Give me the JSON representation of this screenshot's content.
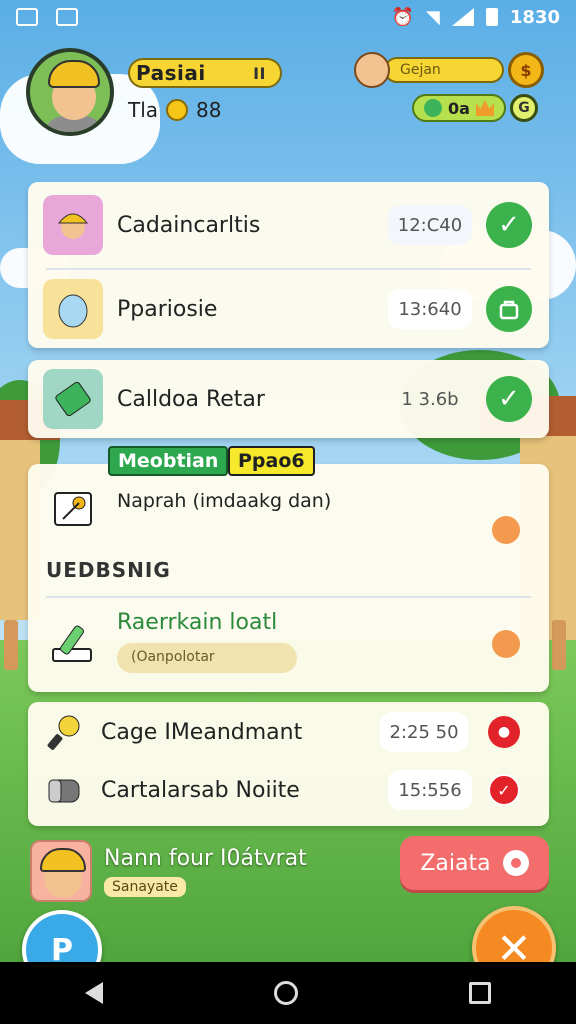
{
  "status_bar": {
    "left_icons": [
      "notification-icon",
      "gallery-icon"
    ],
    "right_icons": [
      "alarm-icon",
      "wifi-icon",
      "signal-icon",
      "battery-icon"
    ],
    "time": "1830"
  },
  "player": {
    "name": "Pasiai",
    "pause_label": "II",
    "level_prefix": "Tla",
    "chick_count": "88"
  },
  "resources": {
    "bar_label": "Gejan",
    "coin_symbol": "$",
    "gem_count": "0a",
    "ring_label": "G"
  },
  "tasks": [
    {
      "label": "Cadaincarltis",
      "time": "12:C40",
      "status": "check"
    },
    {
      "label": "Ppariosie",
      "time": "13:640",
      "status": "bag"
    },
    {
      "label": "Calldoa Retar",
      "time": "1 3.6b",
      "status": "check"
    }
  ],
  "section": {
    "tag_green": "Meobtian",
    "tag_yellow": "Ppao6",
    "item1": "Naprah (imdaakg dan)",
    "heading": "UEDBSNIG",
    "item2_title": "Raerrkain loatl",
    "item2_sub": "(Oanpolotar"
  },
  "events": [
    {
      "label": "Cage IMeandmant",
      "time": "2:25 50"
    },
    {
      "label": "Cartalarsab Noiite",
      "time": "15:556"
    }
  ],
  "bottom": {
    "title": "Nann four I0átvrat",
    "sub": "Sanayate",
    "rank_label": "Zaiata",
    "fab_left": "P",
    "fab_right": "✕"
  },
  "colors": {
    "accent_green": "#3bb24c",
    "accent_orange": "#f58a22",
    "accent_red": "#f36d6d",
    "gold": "#f7d634"
  }
}
